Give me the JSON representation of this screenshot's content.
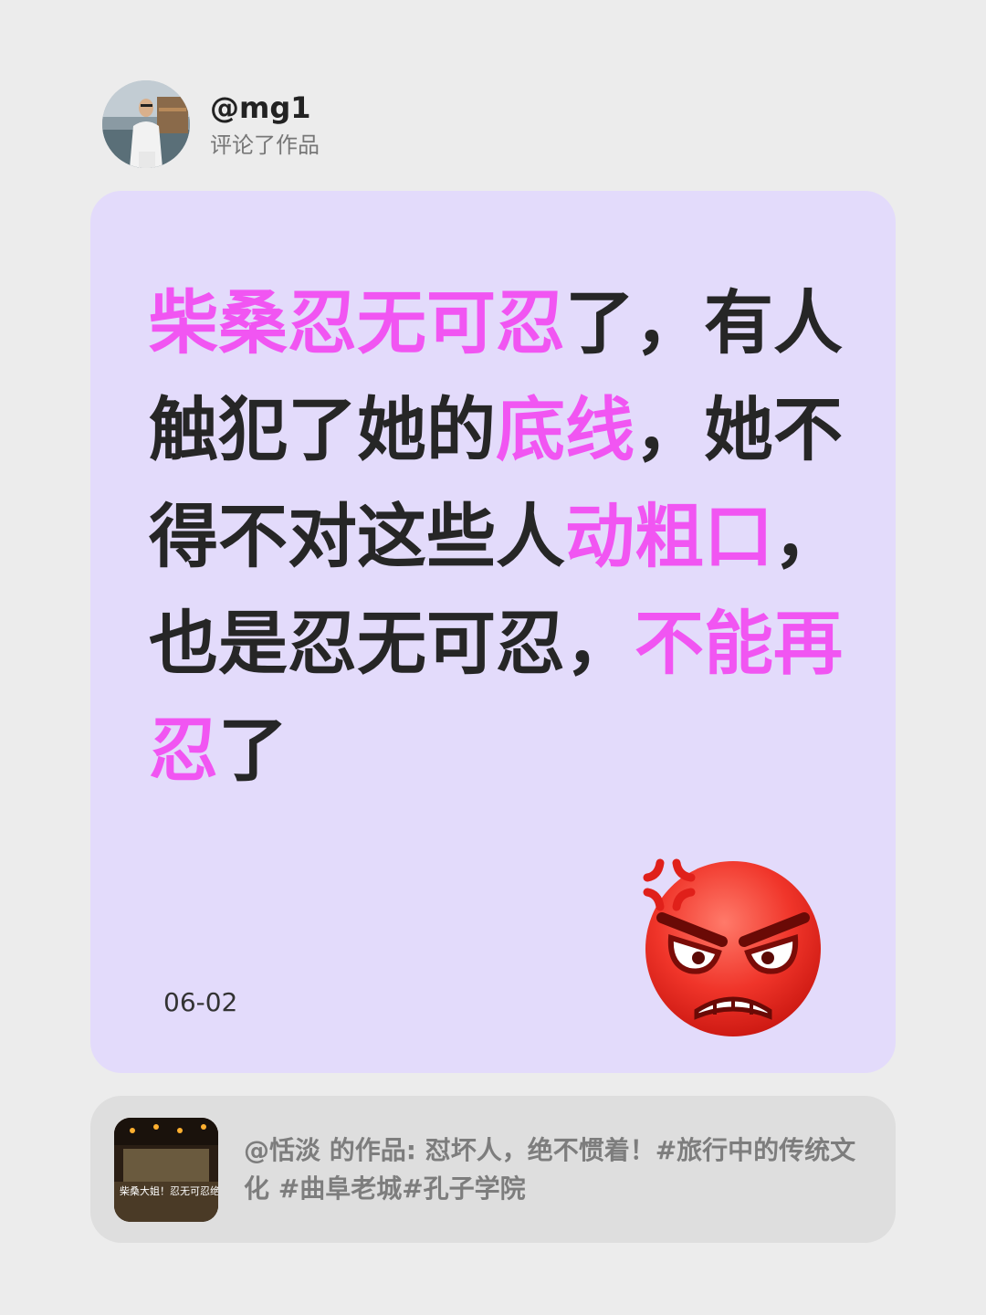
{
  "user": {
    "handle": "@mg1",
    "action": "评论了作品"
  },
  "comment": {
    "segments": [
      {
        "text": "柴桑忍无可忍",
        "highlight": true
      },
      {
        "text": "了，有人触犯了她的",
        "highlight": false
      },
      {
        "text": "底线",
        "highlight": true
      },
      {
        "text": "，她不得不对这些人",
        "highlight": false
      },
      {
        "text": "动粗口",
        "highlight": true
      },
      {
        "text": "，也是忍无可忍，",
        "highlight": false
      },
      {
        "text": "不能再忍",
        "highlight": true
      },
      {
        "text": "了",
        "highlight": false
      }
    ],
    "date": "06-02",
    "emoji": "angry-face-with-anger-symbol"
  },
  "source": {
    "text": "@恬淡 的作品: 怼坏人，绝不惯着！#旅行中的传统文化 #曲阜老城#孔子学院",
    "thumbnail_caption": "柴桑大姐！忍无可忍绝不再忍。"
  },
  "colors": {
    "background": "#ececec",
    "card": "#e3dbfb",
    "highlight": "#f155f2",
    "text": "#262626",
    "source_card": "#dedede"
  }
}
